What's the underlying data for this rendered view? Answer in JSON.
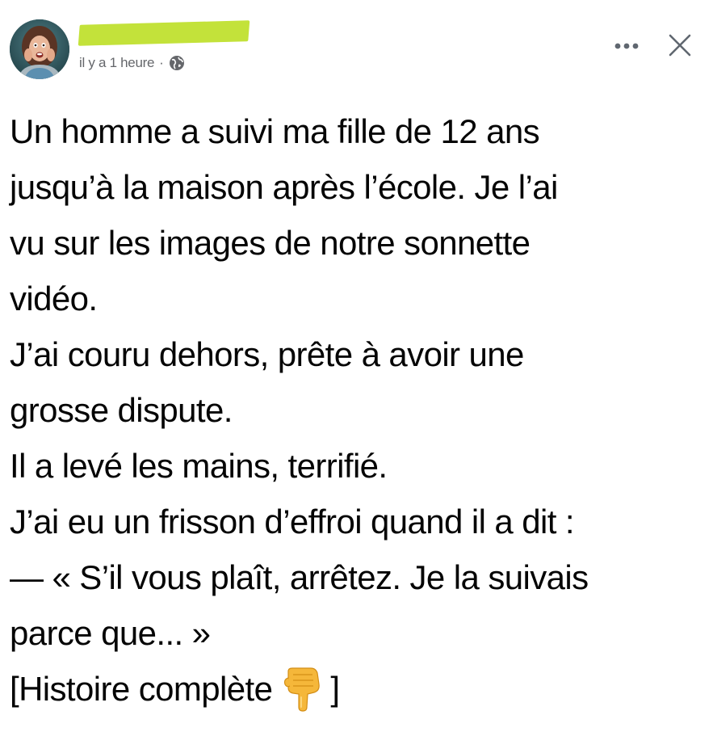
{
  "post": {
    "timestamp": "il y a 1 heure",
    "separator": "·",
    "privacy_icon": "globe-icon",
    "author_name_redacted": true,
    "redaction_color": "#c3e23a",
    "more_icon": "more-horizontal-icon",
    "close_icon": "close-icon"
  },
  "content": {
    "lines": [
      "Un homme a suivi ma fille de 12 ans",
      "jusqu’à la maison après l’école. Je l’ai",
      "vu sur les images de notre sonnette",
      "vidéo.",
      "J’ai couru dehors, prête à avoir une",
      "grosse dispute.",
      "Il a levé les mains, terrifié.",
      "J’ai eu un frisson d’effroi quand il a dit :",
      "— « S’il vous plaît, arrêtez. Je la suivais",
      "parce que... »"
    ],
    "last_line_prefix": "[Histoire complète",
    "last_line_suffix": "]",
    "last_line_icon": "pointing-down-hand-icon"
  }
}
